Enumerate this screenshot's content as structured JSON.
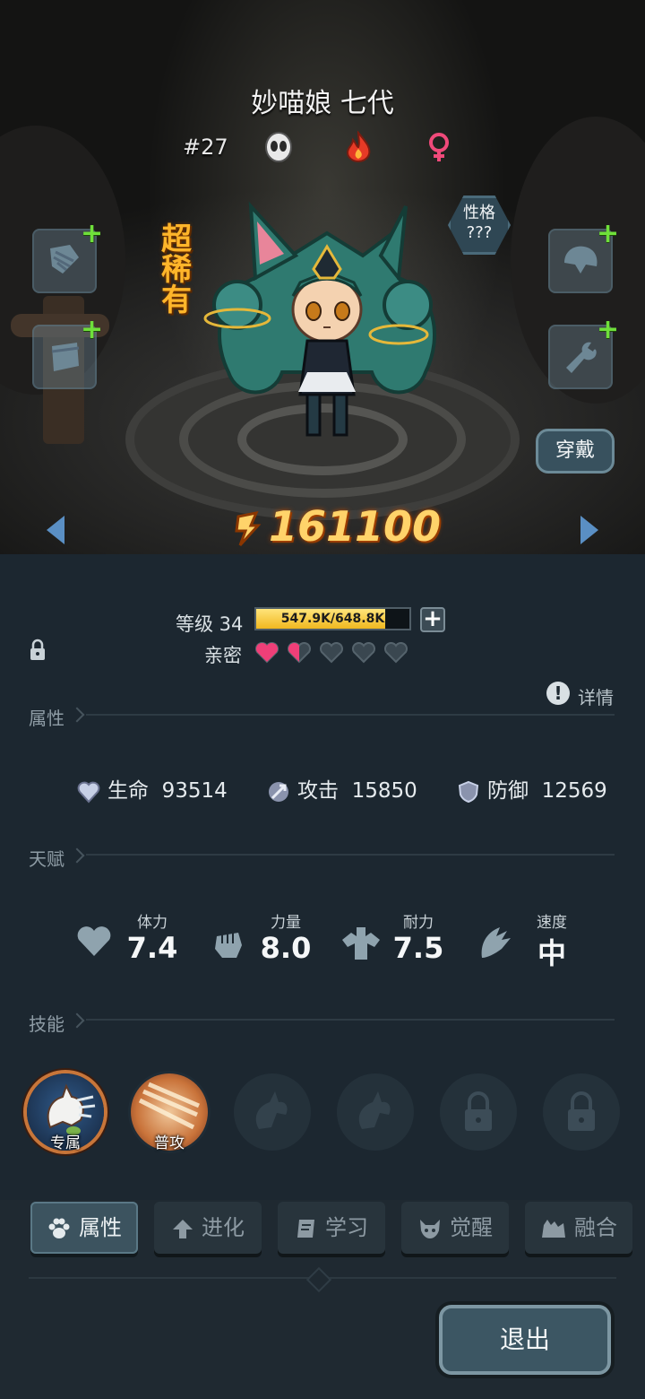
{
  "hero": {
    "name": "妙喵娘 七代",
    "number": "#27",
    "rarity": "超稀有",
    "personality_label": "性格",
    "personality_value": "???",
    "power": "161100",
    "wear_label": "穿戴"
  },
  "level": {
    "label": "等级 34",
    "exp_text": "547.9K/648.8K",
    "exp_fraction": 0.845,
    "intimacy_label": "亲密",
    "hearts": [
      1,
      0.5,
      0,
      0,
      0
    ]
  },
  "details_label": "详情",
  "attributes": {
    "title": "属性",
    "hp_label": "生命",
    "hp_value": "93514",
    "atk_label": "攻击",
    "atk_value": "15850",
    "def_label": "防御",
    "def_value": "12569"
  },
  "talents": {
    "title": "天赋",
    "items": [
      {
        "label": "体力",
        "value": "7.4"
      },
      {
        "label": "力量",
        "value": "8.0"
      },
      {
        "label": "耐力",
        "value": "7.5"
      },
      {
        "label": "速度",
        "value": "中"
      }
    ]
  },
  "skills": {
    "title": "技能",
    "items": [
      {
        "tag": "专属",
        "state": "unlocked"
      },
      {
        "tag": "普攻",
        "state": "unlocked"
      },
      {
        "tag": "",
        "state": "empty"
      },
      {
        "tag": "",
        "state": "empty"
      },
      {
        "tag": "",
        "state": "locked"
      },
      {
        "tag": "",
        "state": "locked"
      }
    ]
  },
  "tabs": [
    "属性",
    "进化",
    "学习",
    "觉醒",
    "融合"
  ],
  "active_tab": "属性",
  "exit_label": "退出",
  "colors": {
    "rarity": "#ffb52a",
    "power": "#ffd36a",
    "heart": "#ef3f78",
    "plus": "#6fe03a"
  }
}
